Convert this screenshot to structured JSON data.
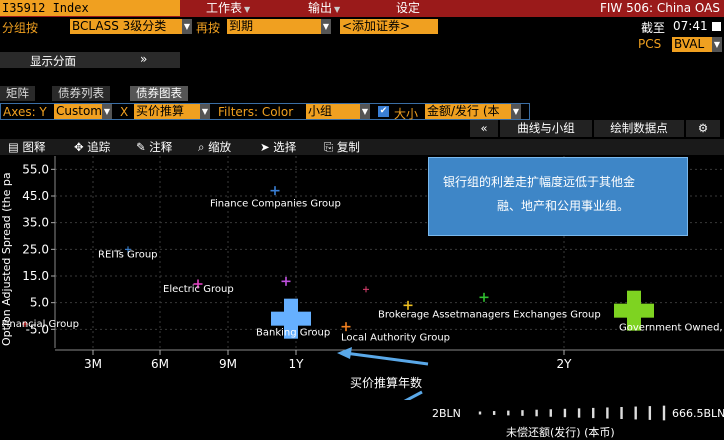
{
  "header": {
    "security": "I35912 Index",
    "menu": [
      {
        "label": "工作表",
        "caret": "▼"
      },
      {
        "label": "输出",
        "caret": "▼"
      },
      {
        "label": "设定",
        "caret": ""
      }
    ],
    "function_title": "FIW 506: China OAS"
  },
  "controls": {
    "group_by_label": "分组按",
    "group_by_value": "BCLASS 3级分类",
    "then_by_label": "再按",
    "then_by_value": "到期",
    "add_security": "<添加证券>",
    "as_of_label": "截至",
    "as_of_time": "07:41",
    "pcs_label": "PCS",
    "pcs_value": "BVAL",
    "show_panels": "显示分面",
    "show_panels_arrow": "»"
  },
  "tabs": [
    {
      "label": "矩阵",
      "active": false
    },
    {
      "label": "债券列表",
      "active": false
    },
    {
      "label": "债券图表",
      "active": true
    }
  ],
  "axes": {
    "axes_label": "Axes: Y",
    "y_value": "Custom",
    "x_label": "X",
    "x_value": "买价推算",
    "filters_label": "Filters: Color",
    "color_value": "小组",
    "size_label": "大小",
    "size_value": "金额/发行 (本"
  },
  "toolbar2": {
    "collapse": "«",
    "curves_groups": "曲线与小组",
    "plot_points": "绘制数据点",
    "gear": "⚙"
  },
  "chart_toolbar": [
    {
      "icon": "table-icon",
      "glyph": "▤",
      "label": "图释"
    },
    {
      "icon": "trace-icon",
      "glyph": "✥",
      "label": "追踪"
    },
    {
      "icon": "annotate-icon",
      "glyph": "✎",
      "label": "注释"
    },
    {
      "icon": "zoom-icon",
      "glyph": "⌕",
      "label": "缩放"
    },
    {
      "icon": "select-icon",
      "glyph": "➤",
      "label": "选择"
    },
    {
      "icon": "copy-icon",
      "glyph": "⎘",
      "label": "复制"
    }
  ],
  "callout": {
    "line1": "银行组的利差走扩幅度远低于其他金",
    "line2": "融、地产和公用事业组。"
  },
  "chart_data": {
    "type": "scatter",
    "ylabel": "Option Adjusted Spread (the pa",
    "xlabel": "买价推算年数",
    "y_ticks": [
      "55.0",
      "45.0",
      "35.0",
      "25.0",
      "15.0",
      "5.0",
      "-5.0"
    ],
    "y_tick_values": [
      55,
      45,
      35,
      25,
      15,
      5,
      -5
    ],
    "x_ticks": [
      "3M",
      "6M",
      "9M",
      "1Y",
      "2Y"
    ],
    "ylim": [
      -12,
      60
    ],
    "grid": true,
    "points": [
      {
        "label": "Finance Companies Group",
        "x": "1Y",
        "y": 47,
        "color": "#3a7fd5",
        "size": "small"
      },
      {
        "label": "REITs Group",
        "x": "9M",
        "y": 25,
        "color": "#3f8be0",
        "size": "tiny"
      },
      {
        "label": "Electric Group",
        "x": "9M",
        "y": 12,
        "color": "#e040c0",
        "size": "small"
      },
      {
        "label": "",
        "x": "1Y",
        "y": 13,
        "color": "#c050e0",
        "size": "small"
      },
      {
        "label": "",
        "x": "1Y",
        "y": 10,
        "color": "#e04070",
        "size": "tiny"
      },
      {
        "label": "Other Financial Group",
        "x": "6M",
        "y": -3,
        "color": "#e03030",
        "size": "tiny"
      },
      {
        "label": "Local Authority Group",
        "x": "1Y",
        "y": -4,
        "color": "#f08020",
        "size": "small"
      },
      {
        "label": "Banking Group",
        "x": "1Y",
        "y": -1,
        "color": "#66b0ff",
        "size": "large"
      },
      {
        "label": "Brokerage Assetmanagers Exchanges Group",
        "x": "1Y",
        "y": 4,
        "color": "#f0c020",
        "size": "small"
      },
      {
        "label": "",
        "x": "2Y",
        "y": 7,
        "color": "#30c030",
        "size": "small"
      },
      {
        "label": "Government Owned, No Guarantee Group",
        "x": "2Y",
        "y": 2,
        "color": "#7ed321",
        "size": "large"
      }
    ]
  },
  "size_legend": {
    "min": "2BLN",
    "max": "666.5BLN",
    "title": "未偿还额(发行) (本币)"
  }
}
